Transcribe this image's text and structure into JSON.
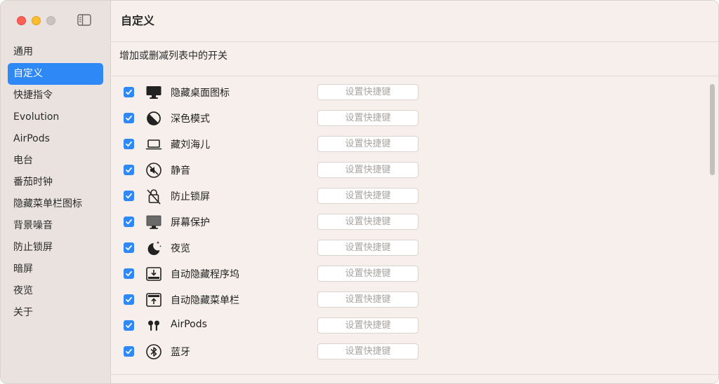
{
  "window": {
    "title": "自定义"
  },
  "sidebar": {
    "items": [
      {
        "label": "通用",
        "active": false
      },
      {
        "label": "自定义",
        "active": true
      },
      {
        "label": "快捷指令",
        "active": false
      },
      {
        "label": "Evolution",
        "active": false
      },
      {
        "label": "AirPods",
        "active": false
      },
      {
        "label": "电台",
        "active": false
      },
      {
        "label": "番茄时钟",
        "active": false
      },
      {
        "label": "隐藏菜单栏图标",
        "active": false
      },
      {
        "label": "背景噪音",
        "active": false
      },
      {
        "label": "防止锁屏",
        "active": false
      },
      {
        "label": "暗屏",
        "active": false
      },
      {
        "label": "夜览",
        "active": false
      },
      {
        "label": "关于",
        "active": false
      }
    ]
  },
  "main": {
    "subtitle": "增加或删减列表中的开关",
    "shortcut_placeholder": "设置快捷键",
    "rows": [
      {
        "label": "隐藏桌面图标",
        "checked": true,
        "icon": "desktop-icon"
      },
      {
        "label": "深色模式",
        "checked": true,
        "icon": "dark-mode-icon"
      },
      {
        "label": "藏刘海儿",
        "checked": true,
        "icon": "laptop-icon"
      },
      {
        "label": "静音",
        "checked": true,
        "icon": "mute-icon"
      },
      {
        "label": "防止锁屏",
        "checked": true,
        "icon": "lock-slash-icon"
      },
      {
        "label": "屏幕保护",
        "checked": true,
        "icon": "monitor-icon"
      },
      {
        "label": "夜览",
        "checked": true,
        "icon": "moon-stars-icon"
      },
      {
        "label": "自动隐藏程序坞",
        "checked": true,
        "icon": "dock-hide-icon"
      },
      {
        "label": "自动隐藏菜单栏",
        "checked": true,
        "icon": "menubar-hide-icon"
      },
      {
        "label": "AirPods",
        "checked": true,
        "icon": "airpods-icon"
      },
      {
        "label": "蓝牙",
        "checked": true,
        "icon": "bluetooth-icon"
      }
    ]
  },
  "colors": {
    "accent": "#2e88f6",
    "background": "#f6efeb",
    "sidebar": "#e9e2df"
  }
}
